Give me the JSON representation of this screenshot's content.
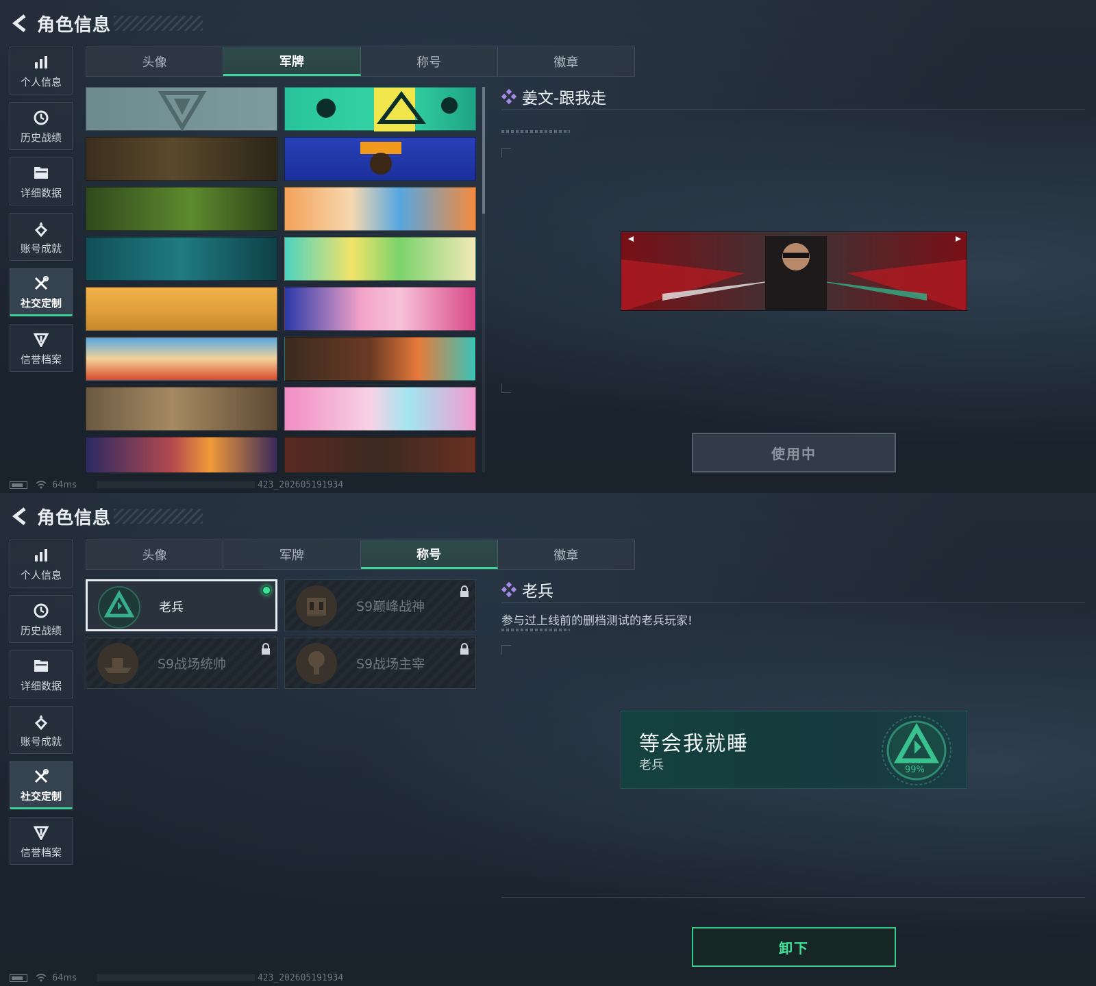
{
  "header": {
    "title": "角色信息"
  },
  "sidebar": {
    "items": [
      {
        "label": "个人信息",
        "icon": "bar-chart-icon"
      },
      {
        "label": "历史战绩",
        "icon": "history-clock-icon"
      },
      {
        "label": "详细数据",
        "icon": "folder-icon"
      },
      {
        "label": "账号成就",
        "icon": "achievement-medal-icon"
      },
      {
        "label": "社交定制",
        "icon": "wrench-tools-icon",
        "active": true
      },
      {
        "label": "信誉档案",
        "icon": "shield-badge-icon"
      }
    ]
  },
  "tabs": [
    "头像",
    "军牌",
    "称号",
    "徽章"
  ],
  "top_panel": {
    "active_tab": "军牌",
    "selected_name": "姜文-跟我走",
    "button_label": "使用中",
    "banners": [
      {
        "name": "default-logo"
      },
      {
        "name": "green-cartoon"
      },
      {
        "name": "weapons-table"
      },
      {
        "name": "blue-orange-visor"
      },
      {
        "name": "night-soldiers-helicopter"
      },
      {
        "name": "orange-blue-waves"
      },
      {
        "name": "teal-gym"
      },
      {
        "name": "anime-headphones"
      },
      {
        "name": "desert-surreal"
      },
      {
        "name": "pink-city-train"
      },
      {
        "name": "market-street"
      },
      {
        "name": "tribal-feather"
      },
      {
        "name": "wasteland-village"
      },
      {
        "name": "pink-hearts-girl"
      },
      {
        "name": "fireworks"
      },
      {
        "name": "soldiers-squad"
      }
    ]
  },
  "bottom_panel": {
    "active_tab": "称号",
    "selected_name": "老兵",
    "selected_desc": "参与过上线前的删档测试的老兵玩家!",
    "preview_title": "等会我就睡",
    "preview_subtitle": "老兵",
    "preview_emblem_text": "99%",
    "button_label": "卸下",
    "titles": [
      {
        "label": "老兵",
        "selected": true,
        "locked": false
      },
      {
        "label": "S9巅峰战神",
        "selected": false,
        "locked": true
      },
      {
        "label": "S9战场统帅",
        "selected": false,
        "locked": true
      },
      {
        "label": "S9战场主宰",
        "selected": false,
        "locked": true
      }
    ]
  },
  "status": {
    "ping": "64ms",
    "session_id": "423_202605191934"
  },
  "colors": {
    "accent": "#3fd39a",
    "diamond": "#a889e8"
  }
}
